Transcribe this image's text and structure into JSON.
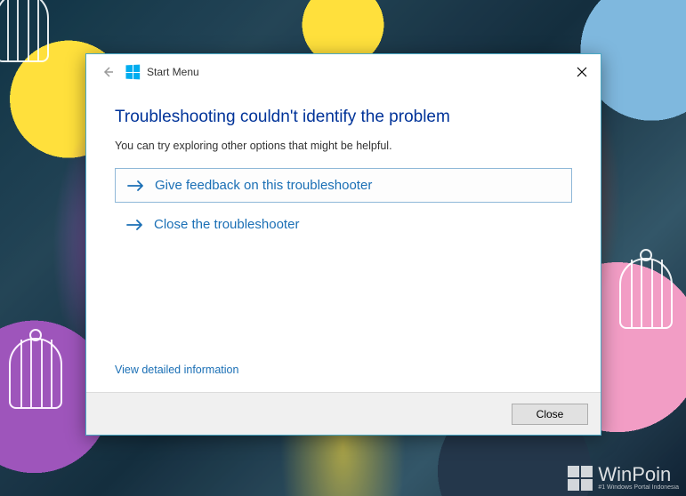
{
  "header": {
    "title": "Start Menu"
  },
  "main": {
    "heading": "Troubleshooting couldn't identify the problem",
    "subtext": "You can try exploring other options that might be helpful.",
    "options": {
      "feedback": "Give feedback on this troubleshooter",
      "close": "Close the troubleshooter"
    },
    "detail_link": "View detailed information"
  },
  "footer": {
    "close_button": "Close"
  },
  "watermark": {
    "brand": "WinPoin",
    "tagline": "#1 Windows Portal Indonesia"
  }
}
